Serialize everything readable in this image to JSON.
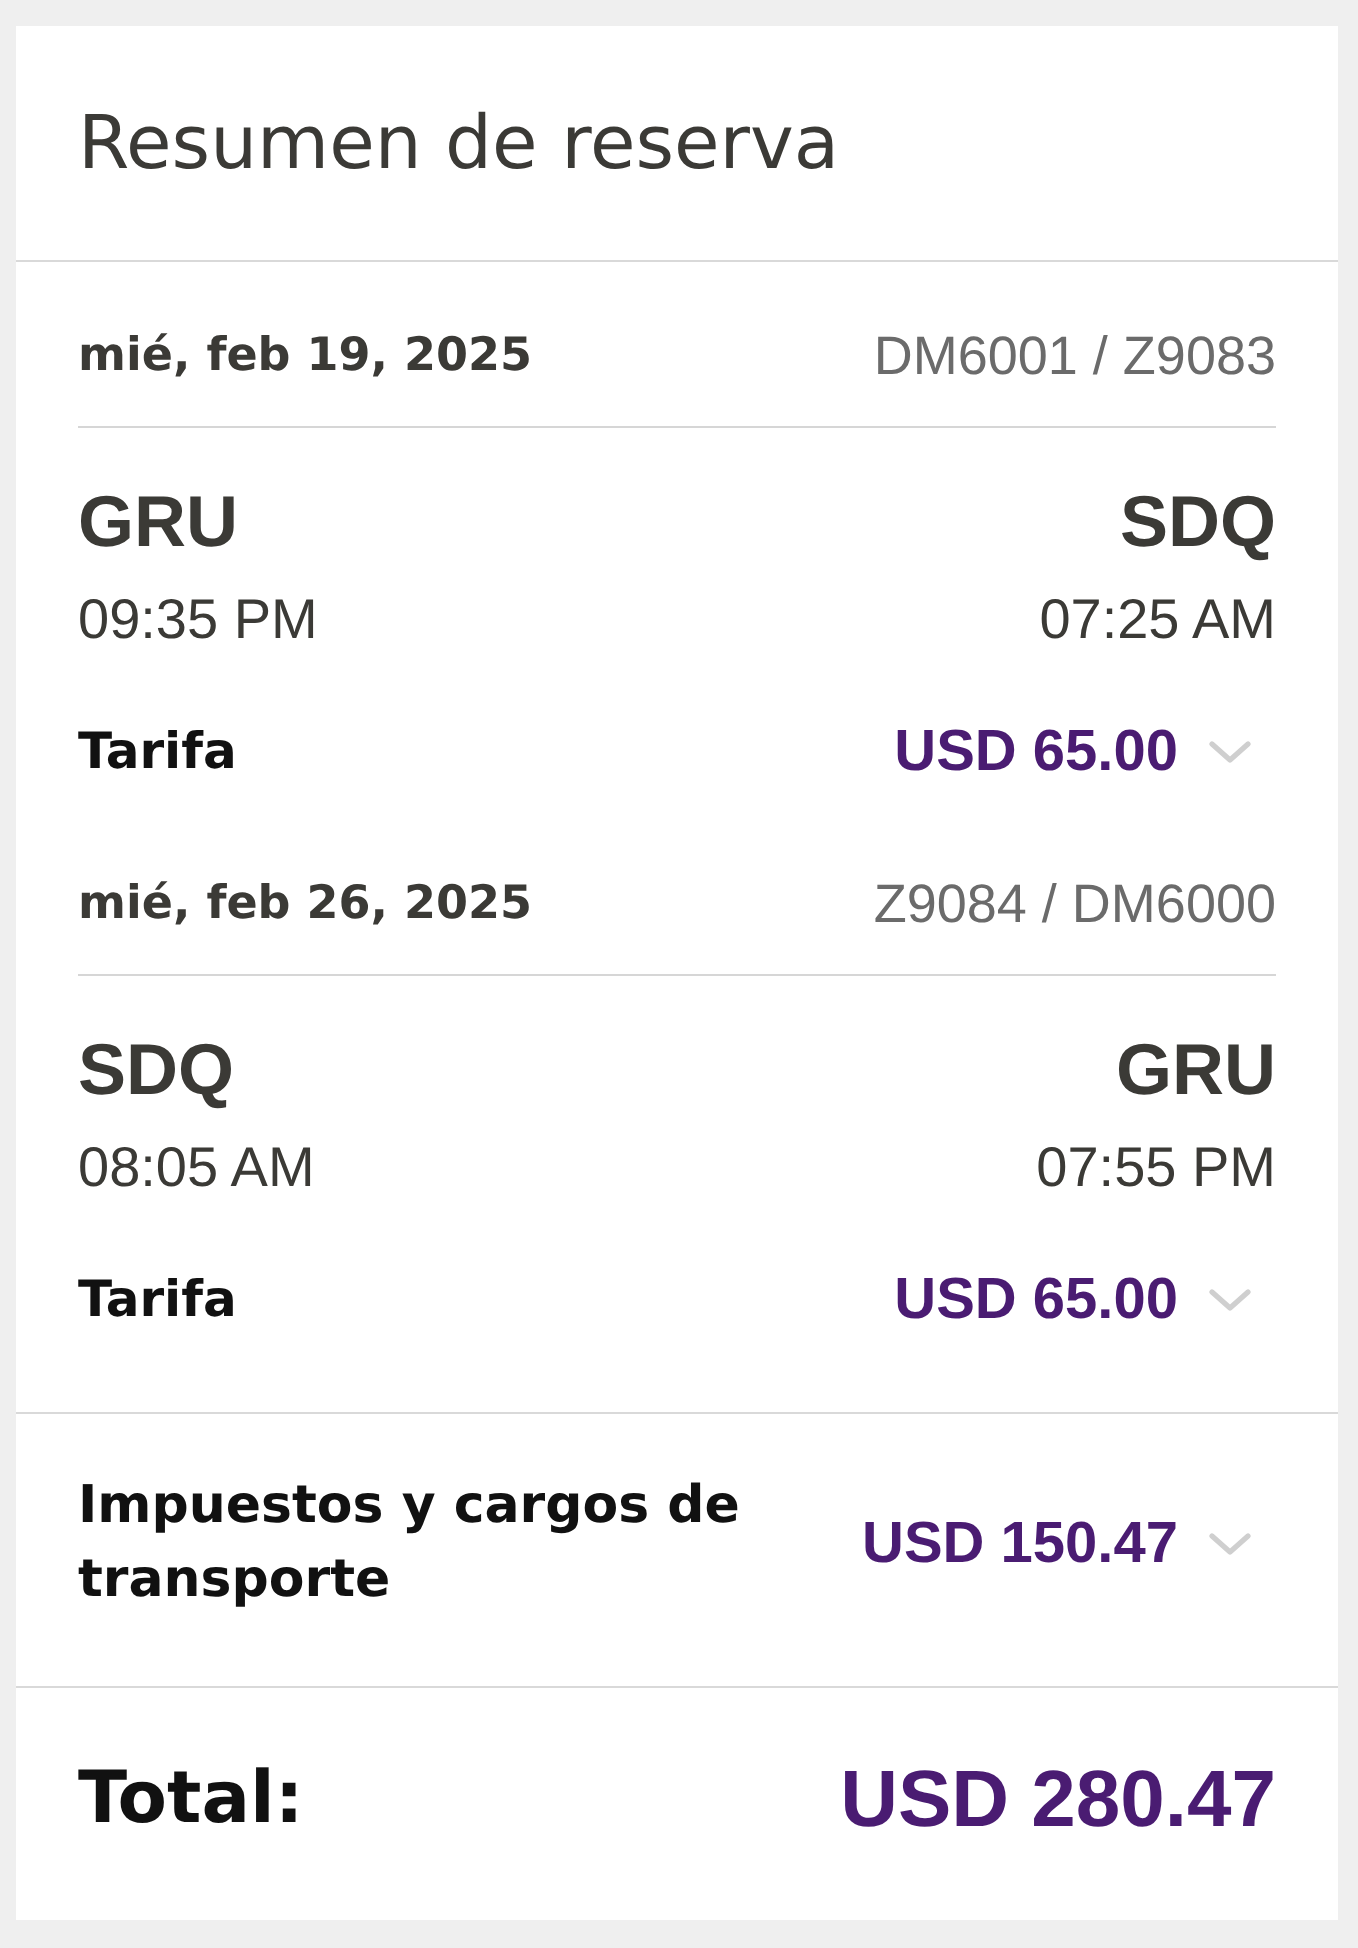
{
  "card": {
    "title": "Resumen de reserva"
  },
  "segments": [
    {
      "date": "mié, feb 19, 2025",
      "flights": "DM6001 / Z9083",
      "origin": {
        "code": "GRU",
        "time": "09:35 PM"
      },
      "destination": {
        "code": "SDQ",
        "time": "07:25 AM"
      },
      "fare": {
        "label": "Tarifa",
        "amount": "USD 65.00",
        "expanded": false
      }
    },
    {
      "date": "mié, feb 26, 2025",
      "flights": "Z9084 / DM6000",
      "origin": {
        "code": "SDQ",
        "time": "08:05 AM"
      },
      "destination": {
        "code": "GRU",
        "time": "07:55 PM"
      },
      "fare": {
        "label": "Tarifa",
        "amount": "USD 65.00",
        "expanded": false
      }
    }
  ],
  "taxes": {
    "label": "Impuestos y cargos de transporte",
    "amount": "USD 150.47",
    "expanded": false
  },
  "total": {
    "label": "Total:",
    "amount": "USD 280.47"
  }
}
